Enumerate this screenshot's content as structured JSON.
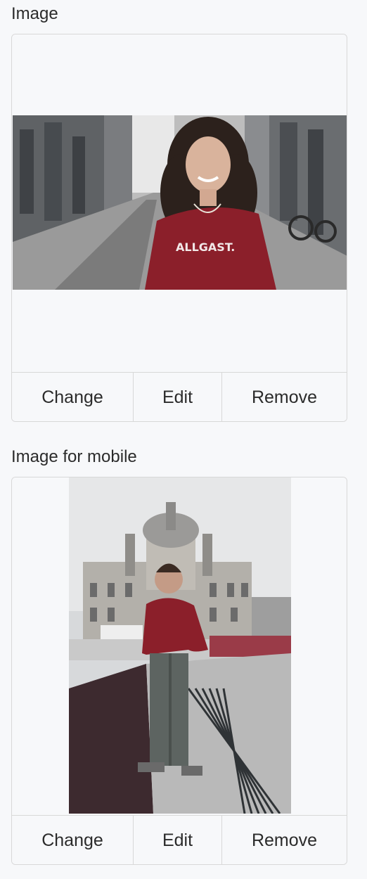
{
  "desktop": {
    "label": "Image",
    "actions": {
      "change": "Change",
      "edit": "Edit",
      "remove": "Remove"
    }
  },
  "mobile": {
    "label": "Image for mobile",
    "actions": {
      "change": "Change",
      "edit": "Edit",
      "remove": "Remove"
    }
  },
  "colors": {
    "panel_border": "#d8d8d8",
    "panel_bg": "#f6f7f9",
    "sweater": "#8b1f2a",
    "text": "#2b2b2b"
  }
}
